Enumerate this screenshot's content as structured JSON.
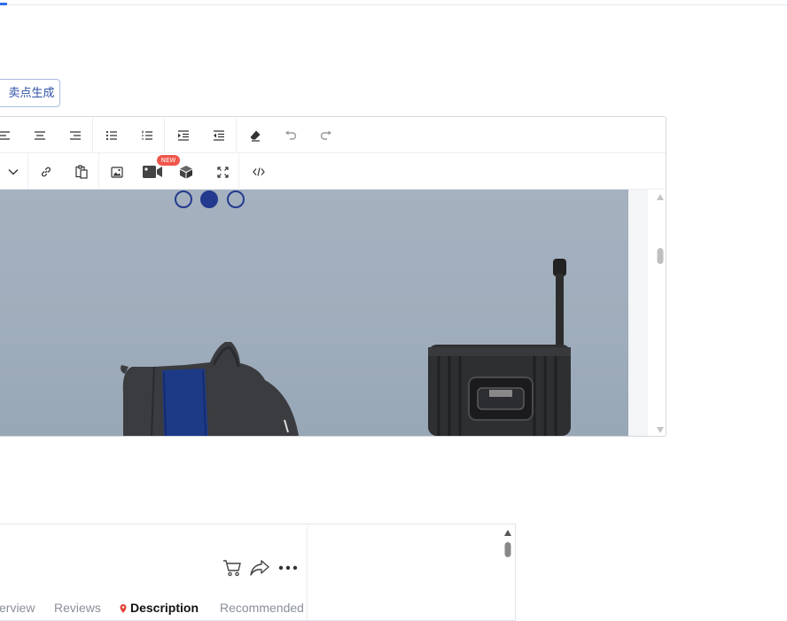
{
  "generate_button": {
    "label": "卖点生成"
  },
  "editor": {
    "toolbar_row1": [
      "align-left-icon",
      "align-center-icon",
      "align-right-icon",
      "bullet-list-icon",
      "numbered-list-icon",
      "indent-icon",
      "outdent-icon",
      "eraser-icon",
      "undo-icon",
      "redo-icon"
    ],
    "toolbar_row2": [
      "chevron-down-icon",
      "link-icon",
      "paste-icon",
      "image-icon",
      "video-icon",
      "cube-icon",
      "fullscreen-icon",
      "code-icon"
    ],
    "new_badge": "NEW",
    "carousel": {
      "slides": 3,
      "active_index": 1
    },
    "colors": {
      "accent": "#243a8f",
      "badge": "#f0564b"
    }
  },
  "preview": {
    "tabs": [
      {
        "label": "erview",
        "active": false
      },
      {
        "label": "Reviews",
        "active": false
      },
      {
        "label": "Description",
        "active": true
      },
      {
        "label": "Recommended",
        "active": false
      }
    ],
    "actions": [
      "cart-icon",
      "share-icon",
      "more-icon"
    ]
  }
}
